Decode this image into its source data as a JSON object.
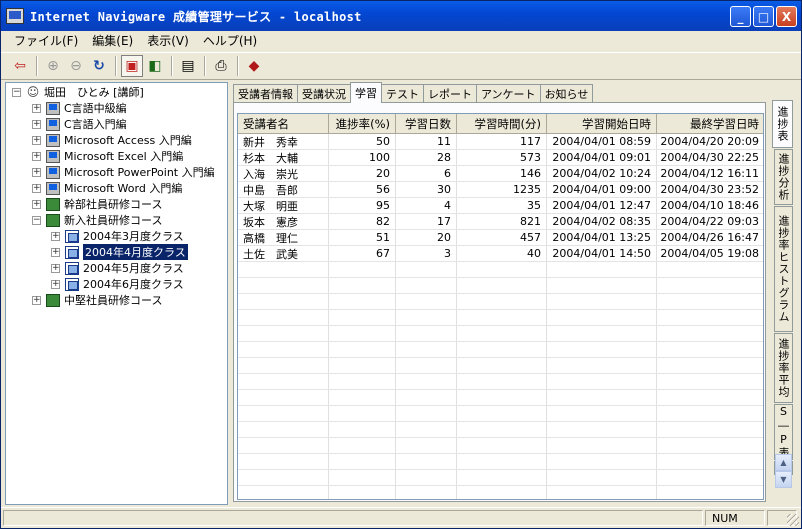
{
  "window": {
    "title": "Internet Navigware 成績管理サービス - localhost"
  },
  "title_buttons": {
    "minimize": "_",
    "maximize": "□",
    "close": "X"
  },
  "menu": [
    "ファイル(F)",
    "編集(E)",
    "表示(V)",
    "ヘルプ(H)"
  ],
  "toolbar": {
    "icons": [
      "exit-icon",
      "zoom-in-icon",
      "zoom-out-icon",
      "refresh-icon",
      "view-split-icon",
      "view-compare-icon",
      "report-icon",
      "print-icon",
      "book-icon"
    ],
    "glyphs": {
      "exit": "⇦",
      "zoom_in": "⊕",
      "zoom_out": "⊖",
      "refresh": "↻",
      "split": "▣",
      "compare": "◧",
      "report": "▤",
      "print": "⎙",
      "book": "◆"
    }
  },
  "tree": {
    "root": "堀田　ひとみ [講師]",
    "nodes": [
      {
        "label": "C言語中級編"
      },
      {
        "label": "C言語入門編"
      },
      {
        "label": "Microsoft Access 入門編"
      },
      {
        "label": "Microsoft Excel 入門編"
      },
      {
        "label": "Microsoft PowerPoint 入門編"
      },
      {
        "label": "Microsoft Word 入門編"
      },
      {
        "label": "幹部社員研修コース"
      },
      {
        "label": "新入社員研修コース"
      },
      {
        "label": "2004年3月度クラス"
      },
      {
        "label": "2004年4月度クラス"
      },
      {
        "label": "2004年5月度クラス"
      },
      {
        "label": "2004年6月度クラス"
      },
      {
        "label": "中堅社員研修コース"
      }
    ]
  },
  "tabs": [
    "受講者情報",
    "受講状況",
    "学習",
    "テスト",
    "レポート",
    "アンケート",
    "お知らせ"
  ],
  "active_tab": "学習",
  "vtabs": [
    "進捗表",
    "進捗分析",
    "進捗率ヒストグラム",
    "進捗率平均",
    "S―P表",
    "ア"
  ],
  "table": {
    "headers": [
      "受講者名",
      "進捗率(%)",
      "学習日数",
      "学習時間(分)",
      "学習開始日時",
      "最終学習日時"
    ],
    "rows": [
      [
        "新井　秀幸",
        "50",
        "11",
        "117",
        "2004/04/01 08:59",
        "2004/04/20 20:09"
      ],
      [
        "杉本　大輔",
        "100",
        "28",
        "573",
        "2004/04/01 09:01",
        "2004/04/30 22:25"
      ],
      [
        "入海　崇光",
        "20",
        "6",
        "146",
        "2004/04/02 10:24",
        "2004/04/12 16:11"
      ],
      [
        "中島　吾郎",
        "56",
        "30",
        "1235",
        "2004/04/01 09:00",
        "2004/04/30 23:52"
      ],
      [
        "大塚　明亜",
        "95",
        "4",
        "35",
        "2004/04/01 12:47",
        "2004/04/10 18:46"
      ],
      [
        "坂本　憲彦",
        "82",
        "17",
        "821",
        "2004/04/02 08:35",
        "2004/04/22 09:03"
      ],
      [
        "高橋　理仁",
        "51",
        "20",
        "457",
        "2004/04/01 13:25",
        "2004/04/26 16:47"
      ],
      [
        "土佐　武美",
        "67",
        "3",
        "40",
        "2004/04/01 14:50",
        "2004/04/05 19:08"
      ]
    ]
  },
  "status": {
    "mode": "NUM"
  },
  "scroll": {
    "up": "▲",
    "down": "▼"
  }
}
